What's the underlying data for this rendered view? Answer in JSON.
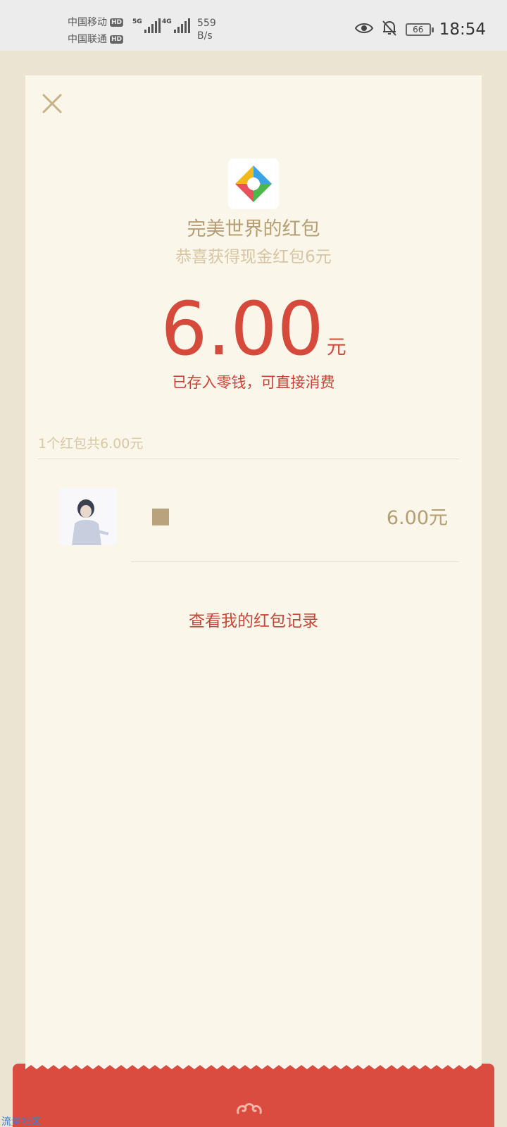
{
  "status_bar": {
    "carrier_1": "中国移动",
    "carrier_2": "中国联通",
    "hd_badge": "HD",
    "network_1": "5G",
    "network_2": "4G",
    "speed_value": "559",
    "speed_unit": "B/s",
    "battery_level": "66",
    "time": "18:54",
    "icons": [
      "eye-icon",
      "bell-off-icon",
      "battery-icon",
      "signal-icon"
    ]
  },
  "packet": {
    "sender_title": "完美世界的红包",
    "subtitle": "恭喜获得现金红包6元",
    "amount": "6.00",
    "amount_unit": "元",
    "deposit_note": "已存入零钱，可直接消费",
    "summary": "1个红包共6.00元",
    "receiver_amount": "6.00元",
    "history_link": "查看我的红包记录"
  },
  "watermark": "流量社区",
  "colors": {
    "accent_red": "#d64a3c",
    "gold": "#b69d72",
    "card_background": "#faf6ea",
    "page_background": "#ece4d2"
  }
}
